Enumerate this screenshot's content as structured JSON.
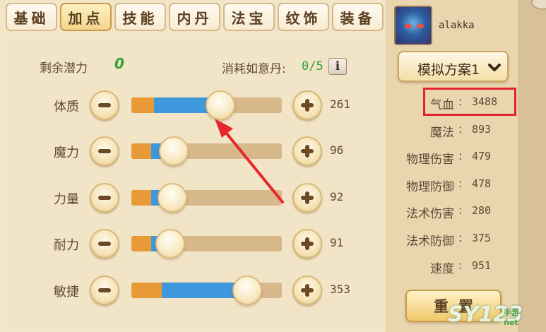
{
  "tabs": [
    {
      "label": "基础",
      "active": false
    },
    {
      "label": "加点",
      "active": true
    },
    {
      "label": "技能",
      "active": false
    },
    {
      "label": "内丹",
      "active": false
    },
    {
      "label": "法宝",
      "active": false
    },
    {
      "label": "纹饰",
      "active": false
    },
    {
      "label": "装备",
      "active": false
    }
  ],
  "points": {
    "potential_label": "剩余潜力",
    "potential_value": "0",
    "cost_label": "消耗如意丹:",
    "cost_value": "0/5",
    "info_label": "i"
  },
  "stats": [
    {
      "label": "体质",
      "value": "261",
      "fill_base": 0.15,
      "fill_added": 0.44
    },
    {
      "label": "魔力",
      "value": "96",
      "fill_base": 0.13,
      "fill_added": 0.15
    },
    {
      "label": "力量",
      "value": "92",
      "fill_base": 0.13,
      "fill_added": 0.14
    },
    {
      "label": "耐力",
      "value": "91",
      "fill_base": 0.13,
      "fill_added": 0.13
    },
    {
      "label": "敏捷",
      "value": "353",
      "fill_base": 0.2,
      "fill_added": 0.57
    }
  ],
  "player": {
    "name": "alakka"
  },
  "plan": {
    "label": "模拟方案1"
  },
  "attributes": [
    {
      "label": "气血",
      "value": "3488",
      "highlighted": true
    },
    {
      "label": "魔法",
      "value": "893"
    },
    {
      "label": "物理伤害",
      "value": "479"
    },
    {
      "label": "物理防御",
      "value": "478"
    },
    {
      "label": "法术伤害",
      "value": "280"
    },
    {
      "label": "法术防御",
      "value": "375"
    },
    {
      "label": "速度",
      "value": "951"
    }
  ],
  "reset_label": "重置",
  "watermark": {
    "main": "SY123",
    "sub": "手游",
    "domain": "net"
  },
  "colors": {
    "accent_green": "#2fa23b",
    "bar_orange": "#e79a35",
    "bar_blue": "#3d98dc",
    "highlight_red": "#e0232d"
  }
}
